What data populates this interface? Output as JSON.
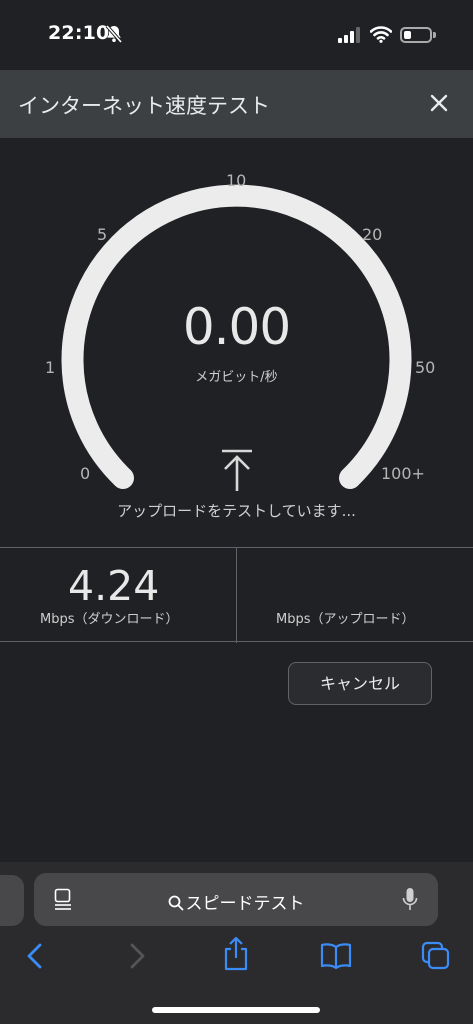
{
  "status_bar": {
    "time": "22:10",
    "icons": [
      "bell-muted-icon",
      "signal-icon",
      "wifi-icon",
      "battery-icon"
    ]
  },
  "header": {
    "title": "インターネット速度テスト",
    "close_icon": "close-icon"
  },
  "gauge": {
    "scale_labels": [
      "0",
      "1",
      "5",
      "10",
      "20",
      "50",
      "100+"
    ],
    "value": "0.00",
    "unit": "メガビット/秒",
    "level": 0,
    "status_text": "アップロードをテストしています..."
  },
  "results": {
    "download": {
      "value": "4.24",
      "label": "Mbps（ダウンロード）"
    },
    "upload": {
      "value": "",
      "label": "Mbps（アップロード）"
    }
  },
  "actions": {
    "cancel_label": "キャンセル"
  },
  "browser": {
    "address_text": "スピードテスト",
    "toolbar": [
      "back-icon",
      "forward-icon",
      "share-icon",
      "bookmarks-icon",
      "tabs-icon"
    ]
  },
  "colors": {
    "accent": "#3b8cf6",
    "background": "#202124",
    "header": "#3c4043"
  }
}
